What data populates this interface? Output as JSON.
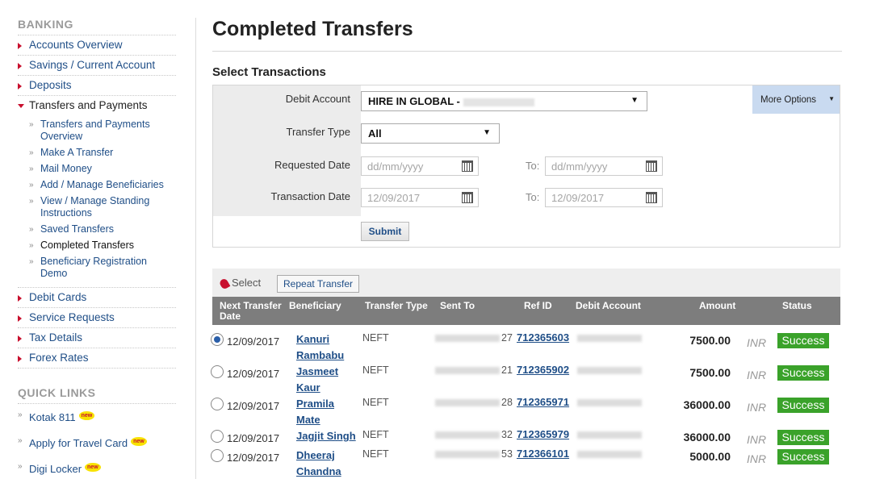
{
  "sidebar": {
    "banking_title": "BANKING",
    "items": [
      {
        "label": "Accounts Overview"
      },
      {
        "label": "Savings / Current Account"
      },
      {
        "label": "Deposits"
      },
      {
        "label": "Transfers and Payments"
      }
    ],
    "sub_items": [
      {
        "label": "Transfers and Payments Overview"
      },
      {
        "label": "Make A Transfer"
      },
      {
        "label": "Mail Money"
      },
      {
        "label": "Add / Manage Beneficiaries"
      },
      {
        "label": "View / Manage Standing Instructions"
      },
      {
        "label": "Saved Transfers"
      },
      {
        "label": "Completed Transfers"
      },
      {
        "label": "Beneficiary Registration Demo"
      }
    ],
    "items_after": [
      {
        "label": "Debit Cards"
      },
      {
        "label": "Service Requests"
      },
      {
        "label": "Tax Details"
      },
      {
        "label": "Forex Rates"
      }
    ],
    "quick_title": "QUICK LINKS",
    "quick_links": [
      {
        "label": "Kotak 811"
      },
      {
        "label": "Apply for Travel Card"
      },
      {
        "label": "Digi Locker"
      }
    ],
    "new_badge": "new"
  },
  "main": {
    "title": "Completed Transfers",
    "section_title": "Select Transactions",
    "filters": {
      "debit_account_label": "Debit Account",
      "debit_account_value": "HIRE IN GLOBAL -",
      "transfer_type_label": "Transfer Type",
      "transfer_type_value": "All",
      "requested_date_label": "Requested Date",
      "requested_from_placeholder": "dd/mm/yyyy",
      "requested_to_placeholder": "dd/mm/yyyy",
      "transaction_date_label": "Transaction Date",
      "transaction_from": "12/09/2017",
      "transaction_to": "12/09/2017",
      "to_label": "To:",
      "more_options": "More Options",
      "submit": "Submit"
    },
    "toolbar": {
      "select_label": "Select",
      "repeat_transfer": "Repeat Transfer"
    },
    "table": {
      "headers": {
        "next_date": "Next Transfer Date",
        "beneficiary": "Beneficiary",
        "transfer_type": "Transfer Type",
        "sent_to": "Sent To",
        "ref_id": "Ref ID",
        "debit_account": "Debit Account",
        "amount": "Amount",
        "status": "Status"
      },
      "rows": [
        {
          "date": "12/09/2017",
          "beneficiary": "Kanuri Rambabu",
          "type": "NEFT",
          "sent_to_suffix": "27",
          "ref_id": "712365603",
          "amount": "7500.00",
          "currency": "INR",
          "status": "Success",
          "selected": true
        },
        {
          "date": "12/09/2017",
          "beneficiary": "Jasmeet Kaur",
          "type": "NEFT",
          "sent_to_suffix": "21",
          "ref_id": "712365902",
          "amount": "7500.00",
          "currency": "INR",
          "status": "Success",
          "selected": false
        },
        {
          "date": "12/09/2017",
          "beneficiary": "Pramila Mate",
          "type": "NEFT",
          "sent_to_suffix": "28",
          "ref_id": "712365971",
          "amount": "36000.00",
          "currency": "INR",
          "status": "Success",
          "selected": false
        },
        {
          "date": "12/09/2017",
          "beneficiary": "Jagjit Singh",
          "type": "NEFT",
          "sent_to_suffix": "32",
          "ref_id": "712365979",
          "amount": "36000.00",
          "currency": "INR",
          "status": "Success",
          "selected": false
        },
        {
          "date": "12/09/2017",
          "beneficiary": "Dheeraj Chandna",
          "type": "NEFT",
          "sent_to_suffix": "53",
          "ref_id": "712366101",
          "amount": "5000.00",
          "currency": "INR",
          "status": "Success",
          "selected": false
        }
      ]
    }
  },
  "colors": {
    "accent_red": "#c8102e",
    "link_blue": "#1f4e87",
    "success_green": "#3aa22a",
    "header_grey": "#7d7d7d"
  }
}
